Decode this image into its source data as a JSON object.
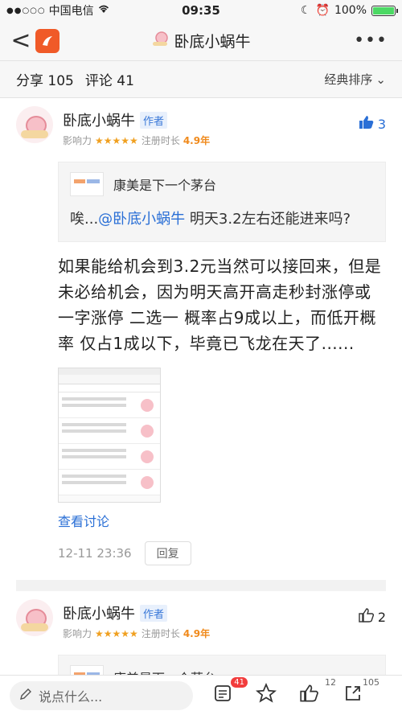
{
  "status_bar": {
    "carrier": "中国电信",
    "time": "09:35",
    "battery": "100%"
  },
  "nav": {
    "back": "<",
    "title": "卧底小蜗牛",
    "more": "•••"
  },
  "tabs": {
    "share": "分享 105",
    "comment": "评论 41",
    "sort": "经典排序",
    "sort_arrow": "⌄"
  },
  "posts": [
    {
      "author": "卧底小蜗牛",
      "badge": "作者",
      "influence_label": "影响力",
      "stars": "★★★★★",
      "reg_label": "注册时长",
      "reg_years": "4.9年",
      "likes": "3",
      "quote_author": "康美是下一个茅台",
      "quote_prefix": "唉...",
      "quote_mention": "@卧底小蜗牛",
      "quote_text": " 明天3.2左右还能进来吗?",
      "content": "如果能给机会到3.2元当然可以接回来，但是未必给机会，因为明天高开高走秒封涨停或一字涨停 二选一 概率占9成以上，而低开概率 仅占1成以下，毕竟已飞龙在天了......",
      "discuss": "查看讨论",
      "time": "12-11 23:36",
      "reply": "回复"
    },
    {
      "author": "卧底小蜗牛",
      "badge": "作者",
      "influence_label": "影响力",
      "stars": "★★★★★",
      "reg_label": "注册时长",
      "reg_years": "4.9年",
      "likes": "2",
      "quote_author": "康美是下一个茅台"
    }
  ],
  "bottom": {
    "placeholder": "说点什么...",
    "comments_count": "41",
    "likes_count": "12",
    "shares_count": "105"
  }
}
